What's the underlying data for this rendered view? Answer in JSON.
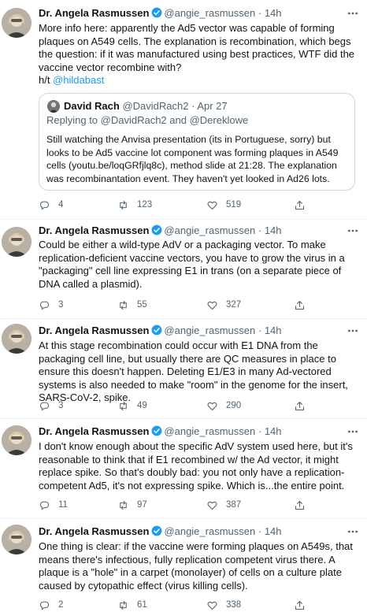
{
  "tweets": [
    {
      "name": "Dr. Angela Rasmussen",
      "handle": "@angie_rasmussen",
      "sep": "·",
      "time": "14h",
      "text": "More info here: apparently the Ad5 vector was capable of forming plaques on A549 cells. The explanation is recombination, which begs the question: if it was manufactured using best practices, WTF did the vaccine vector recombine with?",
      "hat_tip": "h/t",
      "mention": "@hildabast",
      "replies": "4",
      "retweets": "123",
      "likes": "519",
      "quote": {
        "name": "David Rach",
        "handle": "@DavidRach2",
        "sep": "·",
        "time": "Apr 27",
        "replying": "Replying to @DavidRach2 and @Dereklowe",
        "text": "Still watching the Anvisa presentation (its in Portuguese, sorry) but looks to be Ad5 vaccine lot component was forming plaques in A549 cells  (youtu.be/loqGRfjlq8c), method slide at 21:28. The explanation was recombinantation event. They haven't yet looked in Ad26 lots."
      }
    },
    {
      "name": "Dr. Angela Rasmussen",
      "handle": "@angie_rasmussen",
      "sep": "·",
      "time": "14h",
      "text": "Could be either a wild-type AdV or a packaging vector. To make replication-deficient vaccine vectors, you have to grow the virus in a \"packaging\" cell line expressing E1 in trans (on a separate piece of DNA called a plasmid).",
      "replies": "3",
      "retweets": "55",
      "likes": "327"
    },
    {
      "name": "Dr. Angela Rasmussen",
      "handle": "@angie_rasmussen",
      "sep": "·",
      "time": "14h",
      "text": "At this stage recombination could occur with E1 DNA from the packaging cell line, but usually there are QC measures in place to ensure this doesn't happen. Deleting E1/E3 in many Ad-vectored systems is also needed to make \"room\" in the genome for the insert, SARS-CoV-2, spike.",
      "replies": "3",
      "retweets": "49",
      "likes": "290"
    },
    {
      "name": "Dr. Angela Rasmussen",
      "handle": "@angie_rasmussen",
      "sep": "·",
      "time": "14h",
      "text": "I don't know enough about the specific AdV system used here, but it's reasonable to think that if E1 recombined w/ the Ad vector, it might replace spike. So that's doubly bad: you not only have a replication-competent Ad5, it's not expressing spike. Which is...the entire point.",
      "replies": "11",
      "retweets": "97",
      "likes": "387"
    },
    {
      "name": "Dr. Angela Rasmussen",
      "handle": "@angie_rasmussen",
      "sep": "·",
      "time": "14h",
      "text": "One thing is clear: if the vaccine were forming plaques on A549s, that means there's infectious, fully replication competent virus there. A plaque is a \"hole\" in a carpet (monolayer) of cells on a culture plate caused by cytopathic effect (virus killing cells).",
      "replies": "2",
      "retweets": "61",
      "likes": "338"
    }
  ],
  "icons": {
    "verified": "verified-badge-icon",
    "more": "more-options-icon",
    "reply": "reply-icon",
    "retweet": "retweet-icon",
    "like": "heart-icon",
    "share": "share-icon"
  },
  "colors": {
    "accent": "#1d9bf0",
    "text": "#0f1419",
    "muted": "#536471",
    "border": "#cfd9de"
  }
}
